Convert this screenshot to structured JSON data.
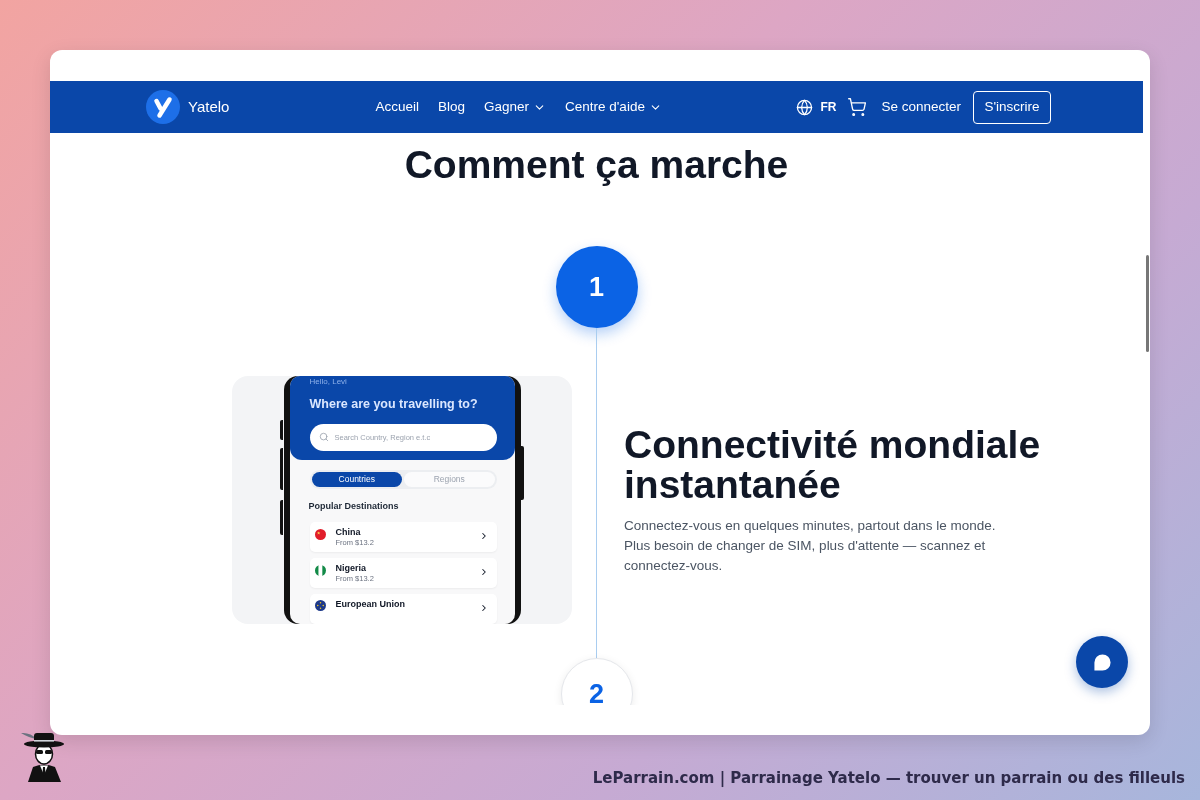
{
  "navbar": {
    "brand": "Yatelo",
    "links": [
      {
        "label": "Accueil",
        "dropdown": false
      },
      {
        "label": "Blog",
        "dropdown": false
      },
      {
        "label": "Gagner",
        "dropdown": true
      },
      {
        "label": "Centre d'aide",
        "dropdown": true
      }
    ],
    "language": "FR",
    "login": "Se connecter",
    "signup": "S'inscrire"
  },
  "section": {
    "title": "Comment ça marche"
  },
  "steps": [
    {
      "number": "1",
      "active": true,
      "preview": {
        "greeting": "Hello, Levi",
        "question": "Where are you travelling to?",
        "search": {
          "placeholder": "Search Country, Region e.t.c"
        },
        "tabs": [
          {
            "label": "Countries",
            "selected": true
          },
          {
            "label": "Regions",
            "selected": false
          }
        ],
        "list_title": "Popular Destinations",
        "destinations": [
          {
            "name": "China",
            "price": "From $13.2"
          },
          {
            "name": "Nigeria",
            "price": "From $13.2"
          },
          {
            "name": "European Union"
          }
        ]
      },
      "title": "Connectivité mondiale instantanée",
      "body_lines": [
        "Connectez-vous en quelques minutes, partout dans le monde.",
        "Plus besoin de changer de SIM, plus d'attente — scannez et",
        "connectez-vous."
      ]
    },
    {
      "number": "2",
      "active": false
    }
  ],
  "caption": "LeParrain.com | Parrainage Yatelo — trouver un parrain ou des filleuls"
}
